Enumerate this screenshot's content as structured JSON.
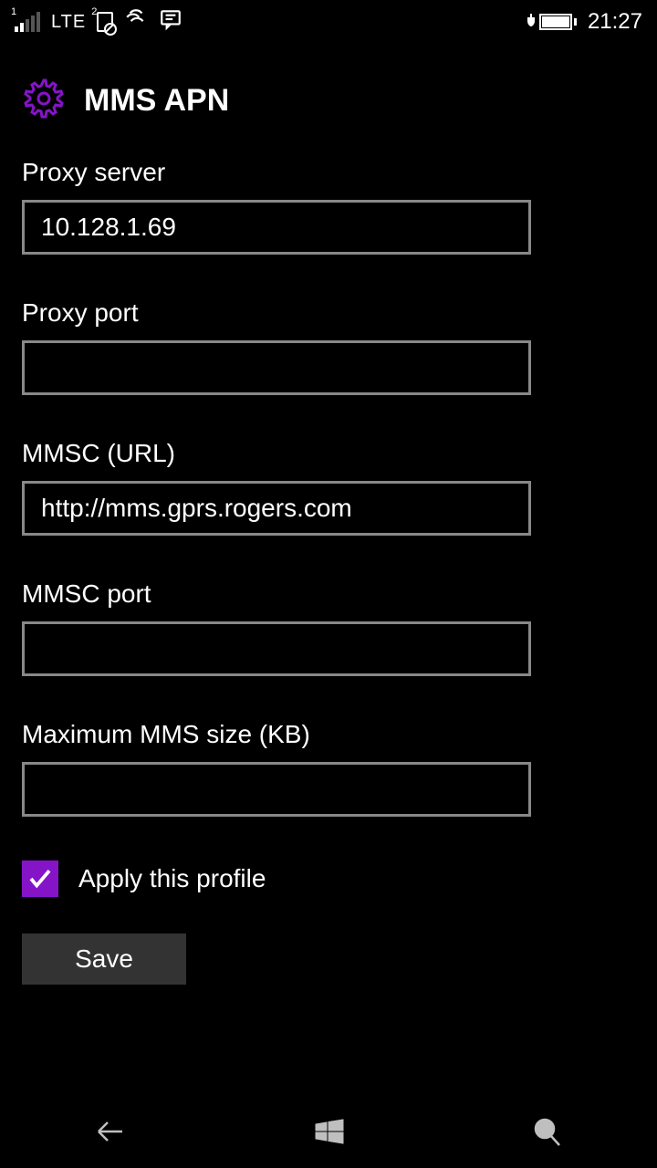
{
  "statusBar": {
    "sim1": "1",
    "network": "LTE",
    "sim2": "2",
    "time": "21:27"
  },
  "header": {
    "title": "MMS APN"
  },
  "fields": {
    "proxyServer": {
      "label": "Proxy server",
      "value": "10.128.1.69"
    },
    "proxyPort": {
      "label": "Proxy port",
      "value": ""
    },
    "mmscUrl": {
      "label": "MMSC (URL)",
      "value": "http://mms.gprs.rogers.com"
    },
    "mmscPort": {
      "label": "MMSC port",
      "value": ""
    },
    "maxMmsSize": {
      "label": "Maximum MMS size (KB)",
      "value": ""
    }
  },
  "applyProfile": {
    "label": "Apply this profile",
    "checked": true
  },
  "buttons": {
    "save": "Save"
  },
  "colors": {
    "accent": "#8514c9"
  }
}
